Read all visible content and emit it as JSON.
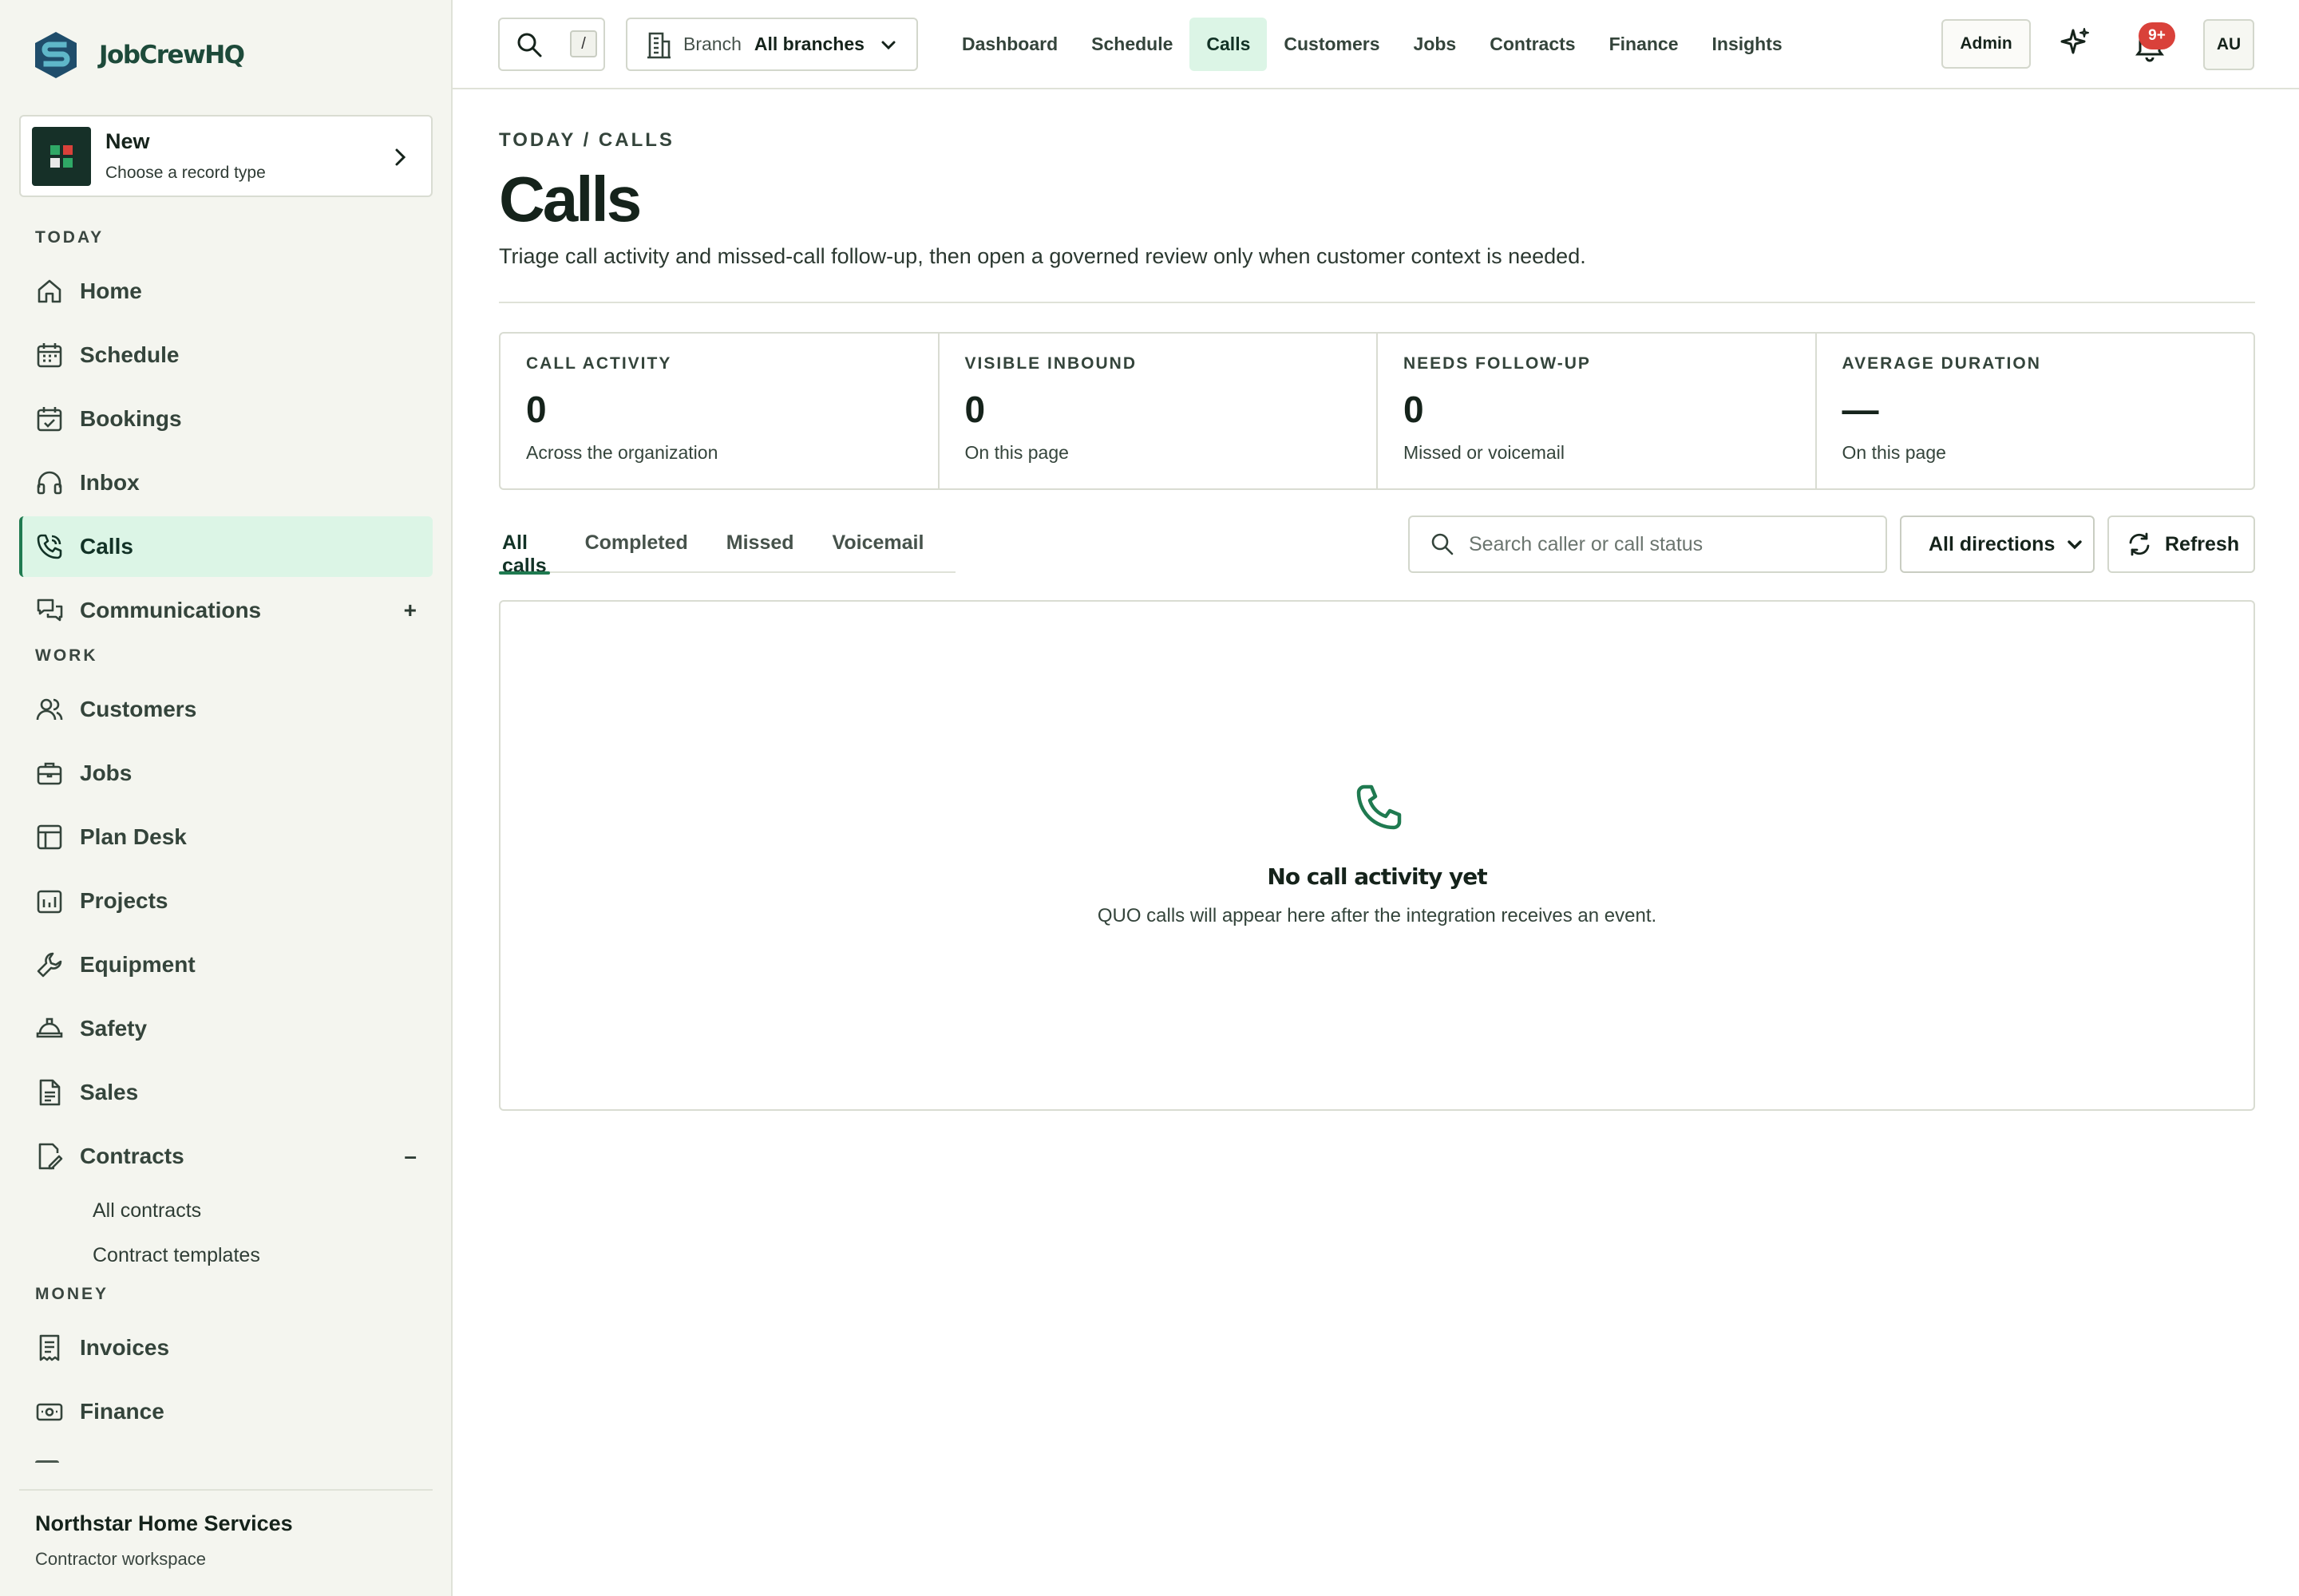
{
  "brand": {
    "name": "JobCrewHQ"
  },
  "new_card": {
    "title": "New",
    "subtitle": "Choose a record type"
  },
  "sidebar": {
    "sections": {
      "today": "TODAY",
      "work": "WORK",
      "money": "MONEY"
    },
    "today_items": [
      {
        "label": "Home",
        "icon": "home-icon"
      },
      {
        "label": "Schedule",
        "icon": "calendar-icon"
      },
      {
        "label": "Bookings",
        "icon": "calendar-check-icon"
      },
      {
        "label": "Inbox",
        "icon": "headset-icon"
      },
      {
        "label": "Calls",
        "icon": "phone-icon",
        "active": true
      },
      {
        "label": "Communications",
        "icon": "chat-icon",
        "suffix": "+"
      }
    ],
    "work_items": [
      {
        "label": "Customers",
        "icon": "users-icon"
      },
      {
        "label": "Jobs",
        "icon": "briefcase-icon"
      },
      {
        "label": "Plan Desk",
        "icon": "layout-icon"
      },
      {
        "label": "Projects",
        "icon": "chart-icon"
      },
      {
        "label": "Equipment",
        "icon": "wrench-icon"
      },
      {
        "label": "Safety",
        "icon": "hardhat-icon"
      },
      {
        "label": "Sales",
        "icon": "document-icon"
      },
      {
        "label": "Contracts",
        "icon": "contract-icon",
        "suffix": "–"
      }
    ],
    "contracts_sub": [
      "All contracts",
      "Contract templates"
    ],
    "money_items": [
      {
        "label": "Invoices",
        "icon": "invoice-icon"
      },
      {
        "label": "Finance",
        "icon": "cash-icon"
      }
    ],
    "footer": {
      "org_name": "Northstar Home Services",
      "org_sub": "Contractor workspace"
    }
  },
  "topbar": {
    "search_shortcut": "/",
    "branch_label": "Branch",
    "branch_value": "All branches",
    "nav": [
      "Dashboard",
      "Schedule",
      "Calls",
      "Customers",
      "Jobs",
      "Contracts",
      "Finance",
      "Insights"
    ],
    "active_nav": "Calls",
    "admin_label": "Admin",
    "notification_badge": "9+",
    "avatar_initials": "AU"
  },
  "page": {
    "breadcrumb": "TODAY / CALLS",
    "title": "Calls",
    "description": "Triage call activity and missed-call follow-up, then open a governed review only when customer context is needed."
  },
  "stats": [
    {
      "label": "CALL ACTIVITY",
      "value": "0",
      "note": "Across the organization"
    },
    {
      "label": "VISIBLE INBOUND",
      "value": "0",
      "note": "On this page"
    },
    {
      "label": "NEEDS FOLLOW-UP",
      "value": "0",
      "note": "Missed or voicemail"
    },
    {
      "label": "AVERAGE DURATION",
      "value": "—",
      "note": "On this page"
    }
  ],
  "tabs": [
    "All calls",
    "Completed",
    "Missed",
    "Voicemail"
  ],
  "active_tab": "All calls",
  "filters": {
    "search_placeholder": "Search caller or call status",
    "direction_value": "All directions",
    "refresh_label": "Refresh"
  },
  "empty_state": {
    "title": "No call activity yet",
    "subtitle": "QUO calls will appear here after the integration receives an event."
  },
  "colors": {
    "accent": "#1f7a50",
    "active_bg": "#dcf5e6",
    "sidebar_bg": "#f4f5ef",
    "badge": "#d9413a"
  }
}
